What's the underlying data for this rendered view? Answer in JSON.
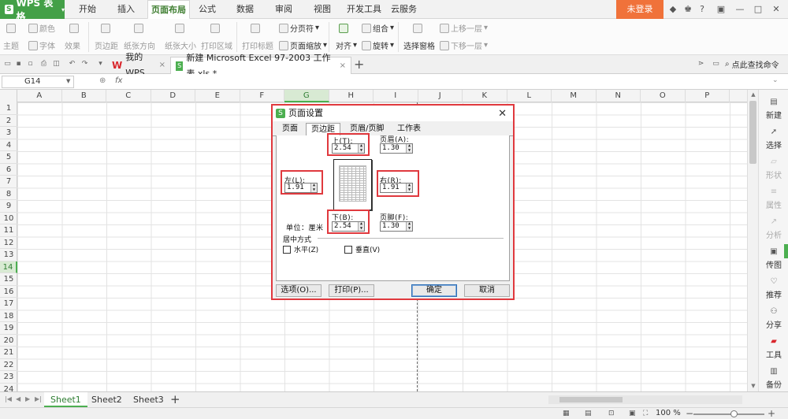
{
  "app": {
    "name": "WPS 表格",
    "menu": [
      "开始",
      "插入",
      "页面布局",
      "公式",
      "数据",
      "审阅",
      "视图",
      "开发工具",
      "云服务"
    ],
    "active_menu": "页面布局",
    "login_label": "未登录"
  },
  "ribbon": {
    "theme": "主题",
    "color": "颜色",
    "font": "字体",
    "effect": "效果",
    "margins": "页边距",
    "orientation": "纸张方向",
    "size": "纸张大小",
    "print_area": "打印区域",
    "print_titles": "打印标题",
    "page_break": "分页符",
    "page_zoom": "页面缩放",
    "align": "对齐",
    "group": "组合",
    "rotate": "旋转",
    "selection_pane": "选择窗格",
    "bring_forward": "上移一层",
    "send_backward": "下移一层"
  },
  "tabs": {
    "wps_tab": "我的WPS",
    "file_tab": "新建 Microsoft Excel 97-2003 工作表.xls *",
    "search": "点此查找命令"
  },
  "formula_bar": {
    "cell_ref": "G14",
    "fx": "fx"
  },
  "grid": {
    "columns": [
      "A",
      "B",
      "C",
      "D",
      "E",
      "F",
      "G",
      "H",
      "I",
      "J",
      "K",
      "L",
      "M",
      "N",
      "O",
      "P"
    ],
    "selected_column": "G",
    "rows": [
      "1",
      "2",
      "3",
      "4",
      "5",
      "6",
      "7",
      "8",
      "9",
      "10",
      "11",
      "12",
      "13",
      "14",
      "15",
      "16",
      "17",
      "18",
      "19",
      "20",
      "21",
      "22",
      "23",
      "24"
    ],
    "selected_row": "14"
  },
  "side_panel": [
    "新建",
    "选择",
    "形状",
    "属性",
    "分析",
    "传图",
    "推荐",
    "分享",
    "工具",
    "备份"
  ],
  "sheets": {
    "tabs": [
      "Sheet1",
      "Sheet2",
      "Sheet3"
    ],
    "active": "Sheet1",
    "add": "+"
  },
  "status": {
    "zoom": "100 %"
  },
  "dialog": {
    "title": "页面设置",
    "tabs": [
      "页面",
      "页边距",
      "页眉/页脚",
      "工作表"
    ],
    "active_tab": "页边距",
    "top_label": "上(T):",
    "top_value": "2.54",
    "header_label": "页眉(A):",
    "header_value": "1.30",
    "left_label": "左(L):",
    "left_value": "1.91",
    "right_label": "右(R):",
    "right_value": "1.91",
    "unit_label": "单位：厘米",
    "bottom_label": "下(B):",
    "bottom_value": "2.54",
    "footer_label": "页脚(F):",
    "footer_value": "1.30",
    "center_section": "居中方式",
    "horizontal": "水平(Z)",
    "vertical": "垂直(V)",
    "options_btn": "选项(O)...",
    "print_btn": "打印(P)...",
    "ok_btn": "确定",
    "cancel_btn": "取消"
  }
}
